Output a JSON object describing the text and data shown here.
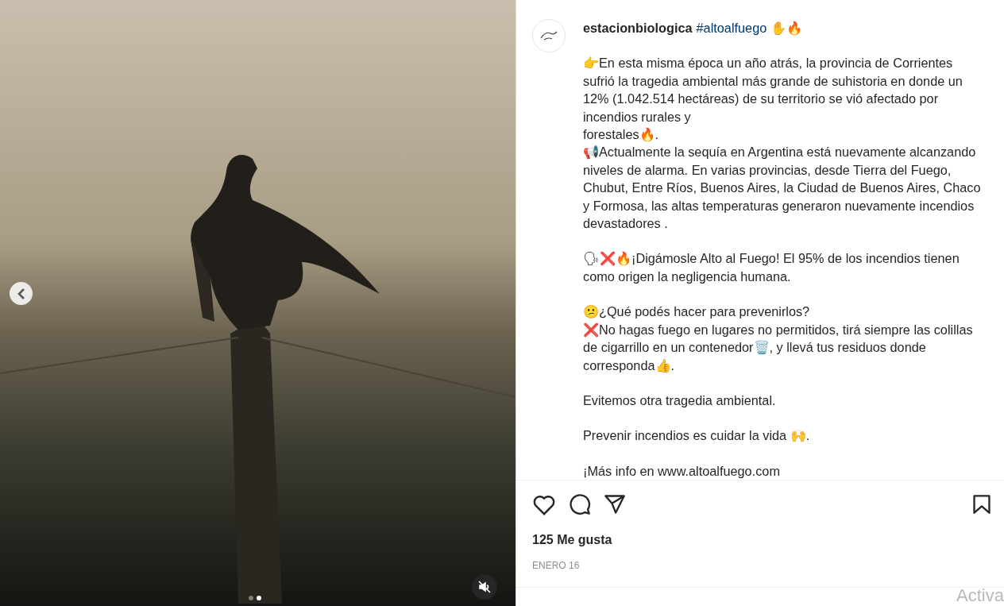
{
  "media": {
    "dots": [
      {
        "selected": false
      },
      {
        "selected": true
      }
    ],
    "muted": true
  },
  "post": {
    "username": "estacionbiologica",
    "hashtag": "#altoalfuego",
    "title_emoji": "✋🔥",
    "caption": [
      [
        "👉En esta misma época un año atrás, la provincia de Corrientes sufrió la tragedia ambiental más grande de suhistoria en donde un 12% (1.042.514 hectáreas) de su territorio se vió afectado por incendios rurales y",
        "forestales🔥.",
        "📢Actualmente la sequía en Argentina está nuevamente alcanzando niveles de alarma. En varias provincias, desde Tierra del Fuego, Chubut, Entre Ríos, Buenos Aires, la Ciudad de Buenos Aires, Chaco y Formosa, las altas temperaturas generaron nuevamente incendios devastadores ."
      ],
      [
        "🗣❌🔥¡Digámosle Alto al Fuego! El 95% de los incendios tienen como origen la negligencia humana."
      ],
      [
        "😕¿Qué podés hacer para prevenirlos?",
        "❌No hagas fuego en lugares no permitidos, tirá siempre las colillas de cigarrillo en un contenedor🗑️, y llevá tus residuos donde corresponda👍."
      ],
      [
        "Evitemos otra tragedia ambiental."
      ],
      [
        "Prevenir incendios es cuidar la vida 🙌."
      ],
      [
        "¡Más info en www.altoalfuego.com"
      ]
    ],
    "liked": false,
    "saved": false,
    "likes": "125 Me gusta",
    "date": "ENERO 16"
  },
  "os_watermark": "Activa"
}
